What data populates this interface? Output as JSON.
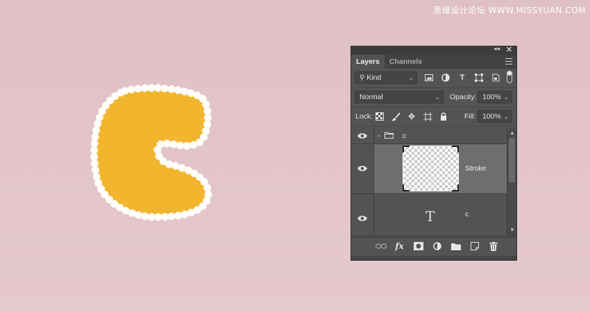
{
  "watermark": "思缘设计论坛 WWW.MISSYUAN.COM",
  "panel": {
    "tabs": [
      {
        "label": "Layers",
        "active": true
      },
      {
        "label": "Channels",
        "active": false
      }
    ],
    "filter": {
      "kind_label": "Kind"
    },
    "blend": {
      "mode": "Normal",
      "opacity_label": "Opacity:",
      "opacity_value": "100%"
    },
    "lock": {
      "lock_label": "Lock:",
      "fill_label": "Fill:",
      "fill_value": "100%"
    },
    "layers": [
      {
        "type": "group",
        "name": "c",
        "expanded": true
      },
      {
        "type": "pixel",
        "name": "Stroke",
        "selected": true
      },
      {
        "type": "text",
        "name": "c"
      }
    ],
    "footer_buttons": [
      "link-layers",
      "fx",
      "add-mask",
      "adjustment-layer",
      "new-group",
      "new-layer",
      "delete"
    ],
    "fx_label": "fx"
  },
  "colors": {
    "background": "#e2c4c8",
    "letter_fill": "#f2b52e",
    "letter_stroke": "#ffffff",
    "panel_bg": "#535353",
    "selected_row": "#6e6e6e"
  }
}
